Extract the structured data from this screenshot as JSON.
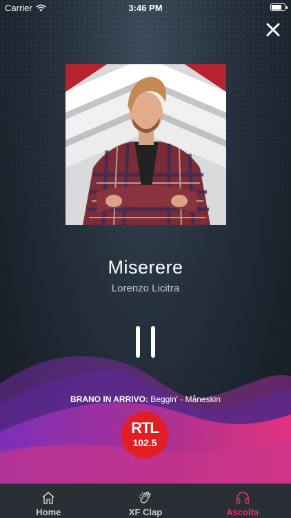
{
  "status_bar": {
    "carrier": "Carrier",
    "time": "3:46 PM",
    "battery_level": 0.8
  },
  "now_playing": {
    "title": "Miserere",
    "artist": "Lorenzo Licitra"
  },
  "next_track": {
    "label": "BRANO IN ARRIVO:",
    "value": " Beggin' - Måneskin"
  },
  "station_logo": {
    "name": "RTL",
    "frequency": "102.5"
  },
  "tabs": [
    {
      "label": "Home",
      "icon": "home-icon",
      "active": false
    },
    {
      "label": "XF Clap",
      "icon": "clap-icon",
      "active": false
    },
    {
      "label": "Ascolta",
      "icon": "headphones-icon",
      "active": true
    }
  ],
  "colors": {
    "accent": "#e0306b",
    "wave_purple": "#7b2bb0",
    "wave_magenta": "#d12f86",
    "logo_red": "#e21d24"
  }
}
